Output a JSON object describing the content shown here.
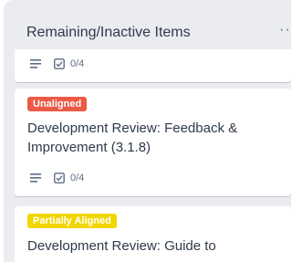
{
  "list": {
    "title": "Remaining/Inactive Items",
    "menu_icon": "ellipsis-icon"
  },
  "cards": [
    {
      "badges": {
        "checklist": "0/4"
      }
    },
    {
      "label": {
        "text": "Unaligned",
        "color": "#eb5a46"
      },
      "title": "Development Review: Feedback & Improvement (3.1.8)",
      "badges": {
        "checklist": "0/4"
      }
    },
    {
      "label": {
        "text": "Partially Aligned",
        "color": "#f2d600"
      },
      "title": "Development Review: Guide to"
    }
  ]
}
